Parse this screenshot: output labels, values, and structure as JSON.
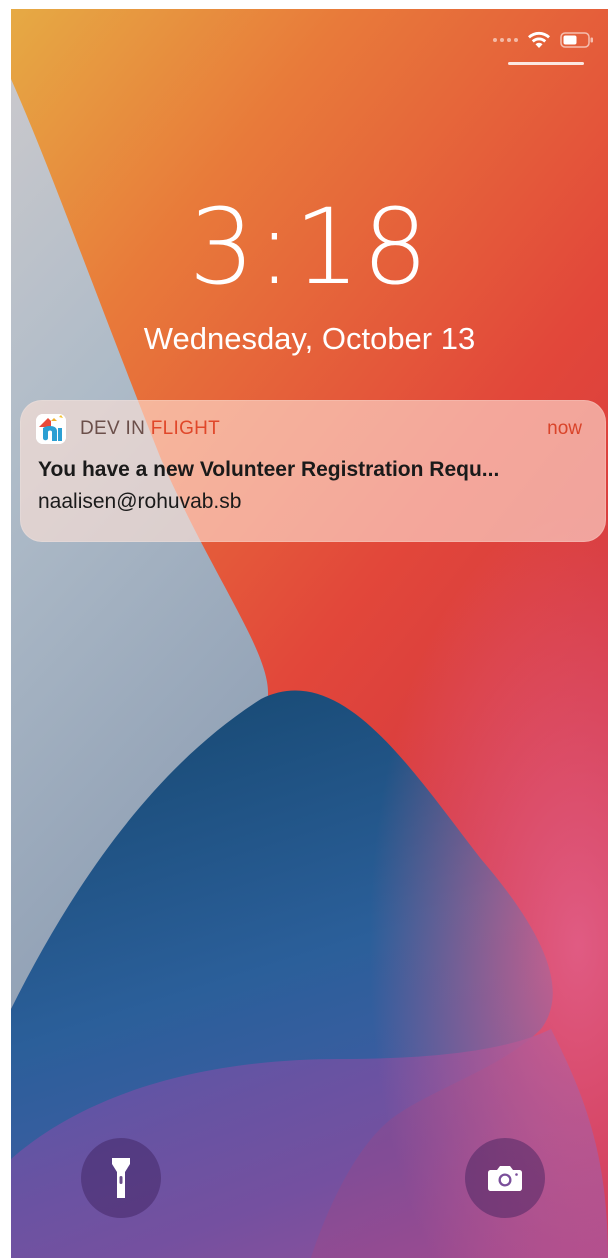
{
  "status_bar": {
    "wifi_icon": "wifi-icon",
    "battery_icon": "battery-icon"
  },
  "lock_screen": {
    "time": "3:18",
    "date": "Wednesday, October 13"
  },
  "notification": {
    "app_name_part1": "DEV IN ",
    "app_name_part2": "FLIGHT",
    "time": "now",
    "title": "You have a new Volunteer Registration Requ...",
    "body": "naalisen@rohuvab.sb",
    "app_icon": "app-logo-icon"
  },
  "quick_actions": {
    "flashlight_icon": "flashlight-icon",
    "camera_icon": "camera-icon"
  },
  "colors": {
    "accent": "#e0472a",
    "wallpaper_orange": "#e9843e",
    "wallpaper_red": "#d93b3b",
    "wallpaper_blue": "#2a5a91",
    "wallpaper_gray": "#a6b5c4",
    "wallpaper_purple": "#8a55a8"
  }
}
